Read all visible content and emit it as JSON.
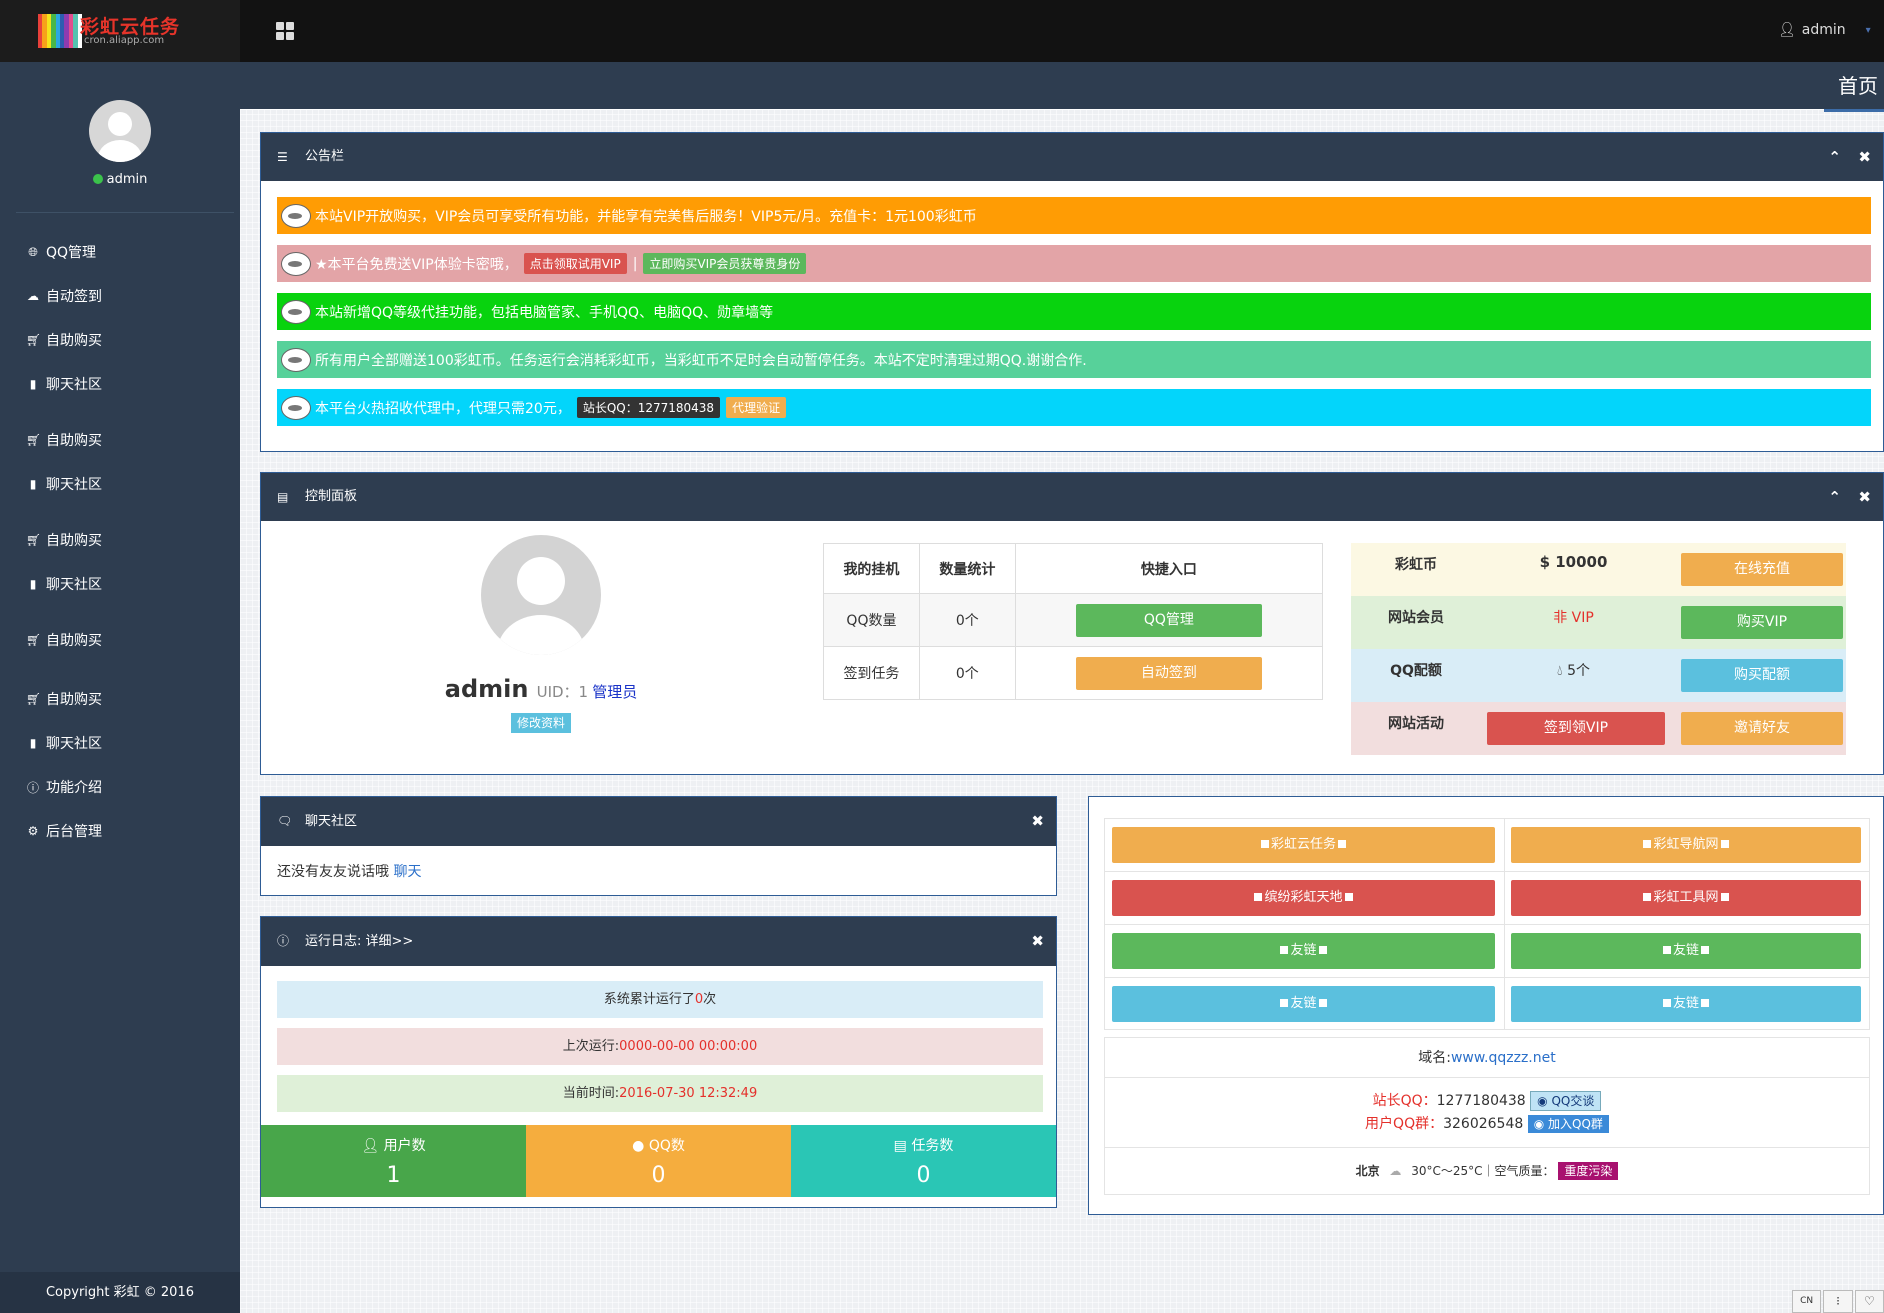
{
  "app": {
    "logo_title": "彩虹云任务",
    "logo_sub": "cron.aliapp.com",
    "logo_colors": [
      "#e8403a",
      "#f7a11a",
      "#f3e41b",
      "#48b748",
      "#2aa7e2",
      "#2d5db0",
      "#8e3bb0",
      "#e34d8e",
      "#55c2b0",
      "#fefefe"
    ],
    "user": "admin",
    "breadcrumb": "首页"
  },
  "sidebar": {
    "username": "admin",
    "items": [
      {
        "label": "QQ管理",
        "icon": "globe-icon"
      },
      {
        "label": "自动签到",
        "icon": "cloud-icon"
      },
      {
        "label": "自助购买",
        "icon": "cart-icon"
      },
      {
        "label": "聊天社区",
        "icon": "comment-icon"
      },
      {
        "label": "自助购买",
        "icon": "cart-icon"
      },
      {
        "label": "聊天社区",
        "icon": "comment-icon"
      },
      {
        "label": "自助购买",
        "icon": "cart-icon"
      },
      {
        "label": "聊天社区",
        "icon": "comment-icon"
      },
      {
        "label": "自助购买",
        "icon": "cart-icon"
      },
      {
        "label": "自助购买",
        "icon": "cart-icon"
      },
      {
        "label": "聊天社区",
        "icon": "comment-icon"
      },
      {
        "label": "功能介绍",
        "icon": "info-icon"
      },
      {
        "label": "后台管理",
        "icon": "gear-icon"
      }
    ],
    "copyright": "Copyright 彩虹 © 2016"
  },
  "notice": {
    "title": "公告栏",
    "items": [
      {
        "text": "本站VIP开放购买，VIP会员可享受所有功能，并能享有完美售后服务！VIP5元/月。充值卡：1元100彩虹币",
        "color": "#ff9c04"
      },
      {
        "text": "★本平台免费送VIP体验卡密哦，",
        "color": "#e3a4a7",
        "tag1": "点击领取试用VIP",
        "sep": "|",
        "tag2": "立即购买VIP会员获尊贵身份"
      },
      {
        "text": "本站新增QQ等级代挂功能，包括电脑管家、手机QQ、电脑QQ、勋章墙等",
        "color": "#08d30e"
      },
      {
        "text": "所有用户全部赠送100彩虹币。任务运行会消耗彩虹币，当彩虹币不足时会自动暂停任务。本站不定时清理过期QQ.谢谢合作.",
        "color": "#57d19a"
      },
      {
        "text": "本平台火热招收代理中，代理只需20元，",
        "color": "#03d5fb",
        "tag1": "站长QQ：1277180438",
        "tag2": "代理验证"
      }
    ]
  },
  "control": {
    "title": "控制面板",
    "username": "admin",
    "uid_label": "UID：1",
    "role": "管理员",
    "edit_button": "修改资料",
    "table": {
      "headers": [
        "我的挂机",
        "数量统计",
        "快捷入口"
      ],
      "rows": [
        {
          "label": "QQ数量",
          "value": "0个",
          "button": "QQ管理"
        },
        {
          "label": "签到任务",
          "value": "0个",
          "button": "自动签到"
        }
      ]
    },
    "wallet": [
      {
        "label": "彩虹币",
        "value": "$ 10000",
        "button": "在线充值",
        "bg": "#fcf8e3"
      },
      {
        "label": "网站会员",
        "value": "非 VIP",
        "button": "购买VIP",
        "bg": "#dff0d8"
      },
      {
        "label": "QQ配额",
        "value": "5个",
        "button": "购买配额",
        "bg": "#d9edf7"
      },
      {
        "label": "网站活动",
        "value": "签到领VIP",
        "button": "邀请好友",
        "bg": "#f2dede"
      }
    ]
  },
  "chat": {
    "title": "聊天社区",
    "text": "还没有友友说话哦",
    "link": "聊天"
  },
  "log": {
    "title": "运行日志:",
    "detail": "详细>>",
    "run_prefix": "系统累计运行了",
    "run_count": "0",
    "run_suffix": "次",
    "last_label": "上次运行:",
    "last_value": "0000-00-00 00:00:00",
    "now_label": "当前时间:",
    "now_value": "2016-07-30 12:32:49",
    "stats": [
      {
        "label": "用户数",
        "value": "1",
        "color": "#48a64a"
      },
      {
        "label": "QQ数",
        "value": "0",
        "color": "#f5ad3e"
      },
      {
        "label": "任务数",
        "value": "0",
        "color": "#2ac6b5"
      }
    ]
  },
  "links": {
    "buttons": [
      {
        "label": "彩虹云任务",
        "color": "#f0ad4e"
      },
      {
        "label": "彩虹导航网",
        "color": "#f0ad4e"
      },
      {
        "label": "缤纷彩虹天地",
        "color": "#d9534f"
      },
      {
        "label": "彩虹工具网",
        "color": "#d9534f"
      },
      {
        "label": "友链",
        "color": "#5cb85c"
      },
      {
        "label": "友链",
        "color": "#5cb85c"
      },
      {
        "label": "友链",
        "color": "#5bc0de"
      },
      {
        "label": "友链",
        "color": "#5bc0de"
      }
    ],
    "domain_label": "域名:",
    "domain": "www.qqzzz.net",
    "owner_label": "站长QQ：",
    "owner_qq": "1277180438",
    "owner_btn": "QQ交谈",
    "group_label": "用户QQ群：",
    "group_qq": "326026548",
    "group_btn": "加入QQ群",
    "weather_city": "北京",
    "weather_text": "30°C～25°C｜空气质量：",
    "weather_badge": "重度污染"
  },
  "corner": [
    "CN",
    "⁝",
    "♡"
  ]
}
